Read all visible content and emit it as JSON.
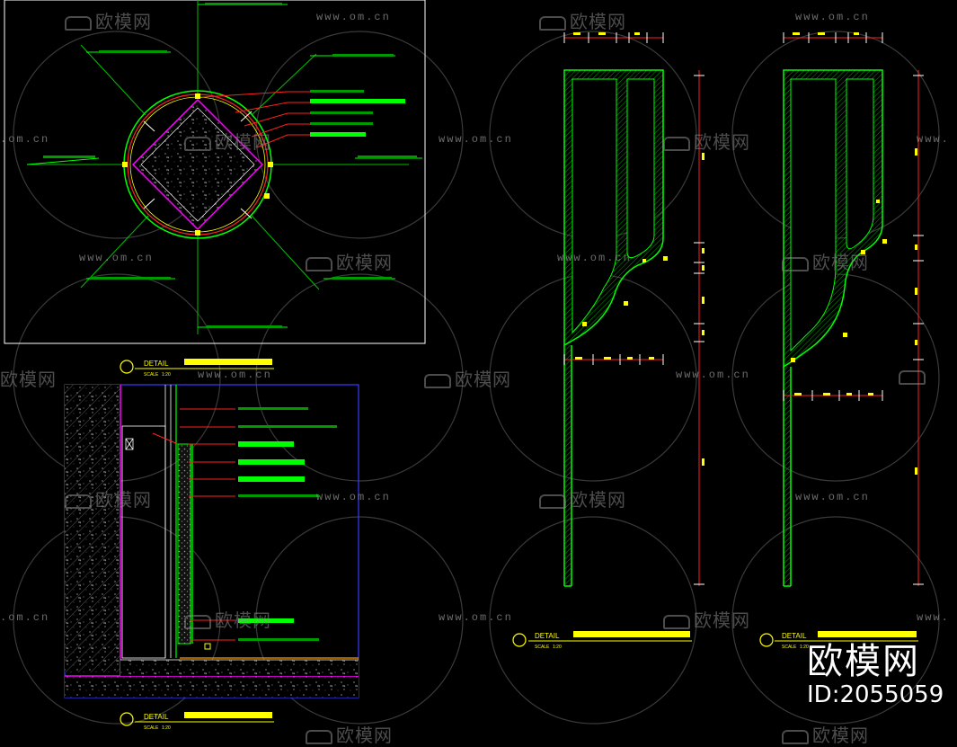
{
  "watermark": {
    "brand_text": "欧模网",
    "url_text": "www.om.cn",
    "url_fragment_start": ".om.cn",
    "url_fragment_end": "www."
  },
  "branding": {
    "name": "欧模网",
    "id_label": "ID:2055059"
  },
  "titles": {
    "detail_label": "DETAIL",
    "scale_label": "SCALE",
    "scale_value": "1:20"
  },
  "colors": {
    "background": "#000000",
    "cad_green": "#00ff00",
    "cad_yellow": "#ffff00",
    "cad_red": "#ff2020",
    "cad_magenta": "#ff00ff",
    "cad_blue": "#3a3aff",
    "cad_white": "#ffffff",
    "cad_orange": "#ff9900",
    "watermark_gray": "#8a8a8a"
  }
}
